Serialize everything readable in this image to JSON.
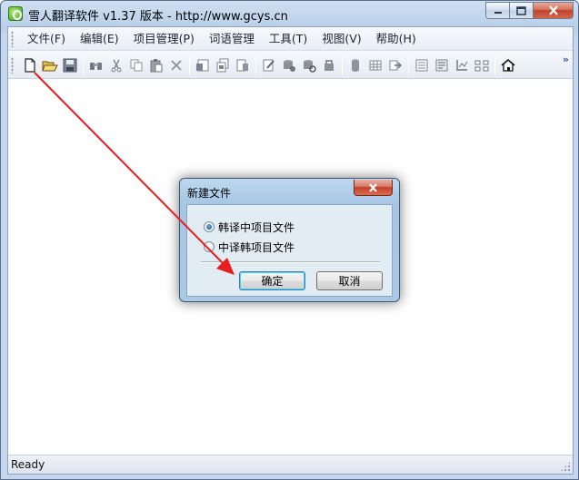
{
  "window": {
    "title": "雪人翻译软件 v1.37 版本 - http://www.gcys.cn"
  },
  "menubar": {
    "items": [
      {
        "label": "文件(F)"
      },
      {
        "label": "编辑(E)"
      },
      {
        "label": "项目管理(P)"
      },
      {
        "label": "词语管理"
      },
      {
        "label": "工具(T)"
      },
      {
        "label": "视图(V)"
      },
      {
        "label": "帮助(H)"
      }
    ]
  },
  "toolbar": {
    "overflow_glyph": "»",
    "icons": [
      "new-file-icon",
      "open-folder-icon",
      "save-icon",
      "find-icon",
      "cut-icon",
      "copy-icon",
      "paste-icon",
      "delete-icon",
      "project-icon",
      "project-copy-icon",
      "project-export-icon",
      "edit-icon",
      "db-icon",
      "db-settings-icon",
      "db-lock-icon",
      "cylinder-icon",
      "table-icon",
      "export-icon",
      "list-icon",
      "doc-icon",
      "tree-icon",
      "structure-icon",
      "home-icon"
    ]
  },
  "statusbar": {
    "text": "Ready"
  },
  "dialog": {
    "title": "新建文件",
    "options": [
      {
        "label": "韩译中项目文件",
        "selected": true
      },
      {
        "label": "中译韩项目文件",
        "selected": false
      }
    ],
    "ok_label": "确定",
    "cancel_label": "取消"
  },
  "colors": {
    "annotation_arrow": "#e81d1d",
    "frame": "#b9cfe8",
    "dialog_frame": "#a6c6e4",
    "close_button": "#c43f29"
  }
}
